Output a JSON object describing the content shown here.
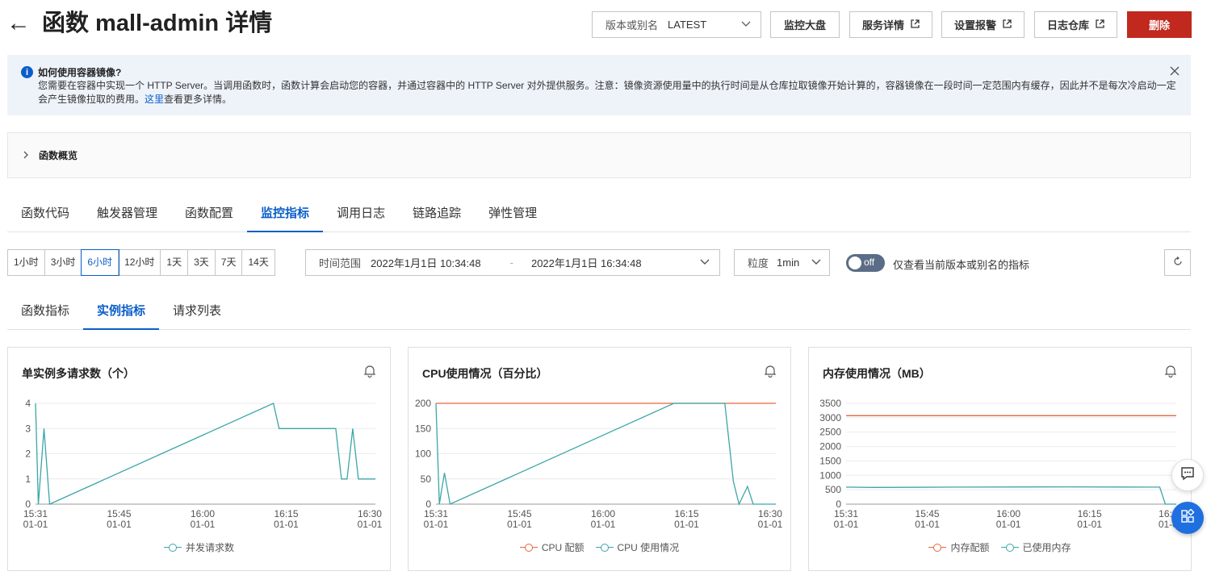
{
  "header": {
    "back_symbol": "←",
    "title": "函数 mall-admin 详情",
    "version_label": "版本或别名",
    "version_value": "LATEST",
    "buttons": {
      "dashboard": "监控大盘",
      "service_detail": "服务详情",
      "alarm": "设置报警",
      "log_store": "日志仓库",
      "delete": "删除"
    }
  },
  "notice": {
    "title": "如何使用容器镜像?",
    "body": "您需要在容器中实现一个 HTTP Server。当调用函数时，函数计算会启动您的容器，并通过容器中的 HTTP Server 对外提供服务。注意：镜像资源使用量中的执行时间是从仓库拉取镜像开始计算的，容器镜像在一段时间一定范围内有缓存，因此并不是每次冷启动一定会产生镜像拉取的费用。",
    "link": "这里",
    "link_suffix": "查看更多详情。"
  },
  "overview": {
    "label": "函数概览"
  },
  "tabs": [
    {
      "label": "函数代码"
    },
    {
      "label": "触发器管理"
    },
    {
      "label": "函数配置"
    },
    {
      "label": "监控指标",
      "active": true
    },
    {
      "label": "调用日志"
    },
    {
      "label": "链路追踪"
    },
    {
      "label": "弹性管理"
    }
  ],
  "time_ranges": [
    "1小时",
    "3小时",
    "6小时",
    "12小时",
    "1天",
    "3天",
    "7天",
    "14天"
  ],
  "time_range_active": "6小时",
  "time_window": {
    "label": "时间范围",
    "start": "2022年1月1日 10:34:48",
    "end": "2022年1月1日 16:34:48",
    "separator": "-"
  },
  "granularity": {
    "label": "粒度",
    "value": "1min"
  },
  "toggle": {
    "state": "off",
    "label": "仅查看当前版本或别名的指标"
  },
  "subtabs": [
    {
      "label": "函数指标"
    },
    {
      "label": "实例指标",
      "active": true
    },
    {
      "label": "请求列表"
    }
  ],
  "colors": {
    "primary": "#0b5ec9",
    "danger": "#c1281e",
    "teal": "#3ba6a8",
    "orange": "#e8673b"
  },
  "charts": [
    {
      "title": "单实例多请求数（个）",
      "legend": [
        "并发请求数"
      ]
    },
    {
      "title": "CPU使用情况（百分比）",
      "legend": [
        "CPU 配额",
        "CPU 使用情况"
      ]
    },
    {
      "title": "内存使用情况（MB）",
      "legend": [
        "内存配额",
        "已使用内存"
      ]
    }
  ],
  "chart_data": [
    {
      "type": "line",
      "x": [
        "15:31\n01-01",
        "15:45\n01-01",
        "16:00\n01-01",
        "16:15\n01-01",
        "16:30\n01-01"
      ],
      "xticks": [
        "15:31",
        "15:45",
        "16:00",
        "16:15",
        "16:30"
      ],
      "xsub": "01-01",
      "ylim": [
        0,
        4
      ],
      "yticks": [
        0,
        1,
        2,
        3,
        4
      ],
      "series": [
        {
          "name": "并发请求数",
          "color": "#3ba6a8",
          "points": [
            [
              0,
              4
            ],
            [
              0.5,
              0
            ],
            [
              1.5,
              3
            ],
            [
              2.5,
              0
            ],
            [
              42,
              4
            ],
            [
              43,
              3
            ],
            [
              53,
              3
            ],
            [
              54,
              1
            ],
            [
              55,
              1
            ],
            [
              56,
              3
            ],
            [
              57,
              1
            ],
            [
              60,
              1
            ]
          ]
        }
      ],
      "xrange": [
        0,
        60
      ]
    },
    {
      "type": "line",
      "xticks": [
        "15:31",
        "15:45",
        "16:00",
        "16:15",
        "16:30"
      ],
      "xsub": "01-01",
      "ylim": [
        0,
        200
      ],
      "yticks": [
        0,
        50,
        100,
        150,
        200
      ],
      "series": [
        {
          "name": "CPU 配额",
          "color": "#e8673b",
          "points": [
            [
              0,
              200
            ],
            [
              60,
              200
            ]
          ]
        },
        {
          "name": "CPU 使用情况",
          "color": "#3ba6a8",
          "points": [
            [
              0,
              200
            ],
            [
              0.6,
              0
            ],
            [
              1.5,
              62
            ],
            [
              2.5,
              0
            ],
            [
              42,
              200
            ],
            [
              51,
              200
            ],
            [
              52.5,
              45
            ],
            [
              53.5,
              0
            ],
            [
              55,
              35
            ],
            [
              56,
              0
            ],
            [
              60,
              0
            ]
          ]
        }
      ],
      "xrange": [
        0,
        60
      ]
    },
    {
      "type": "line",
      "xticks": [
        "15:31",
        "15:45",
        "16:00",
        "16:15",
        "16:30"
      ],
      "xsub": "01-01",
      "ylim": [
        0,
        3500
      ],
      "yticks": [
        0,
        500,
        1000,
        1500,
        2000,
        2500,
        3000,
        3500
      ],
      "series": [
        {
          "name": "内存配额",
          "color": "#e8673b",
          "points": [
            [
              0,
              3072
            ],
            [
              60,
              3072
            ]
          ]
        },
        {
          "name": "已使用内存",
          "color": "#3ba6a8",
          "points": [
            [
              0,
              590
            ],
            [
              5,
              580
            ],
            [
              20,
              590
            ],
            [
              40,
              600
            ],
            [
              55,
              590
            ],
            [
              57,
              590
            ],
            [
              58,
              0
            ],
            [
              60,
              0
            ]
          ]
        }
      ],
      "xrange": [
        0,
        60
      ]
    }
  ]
}
